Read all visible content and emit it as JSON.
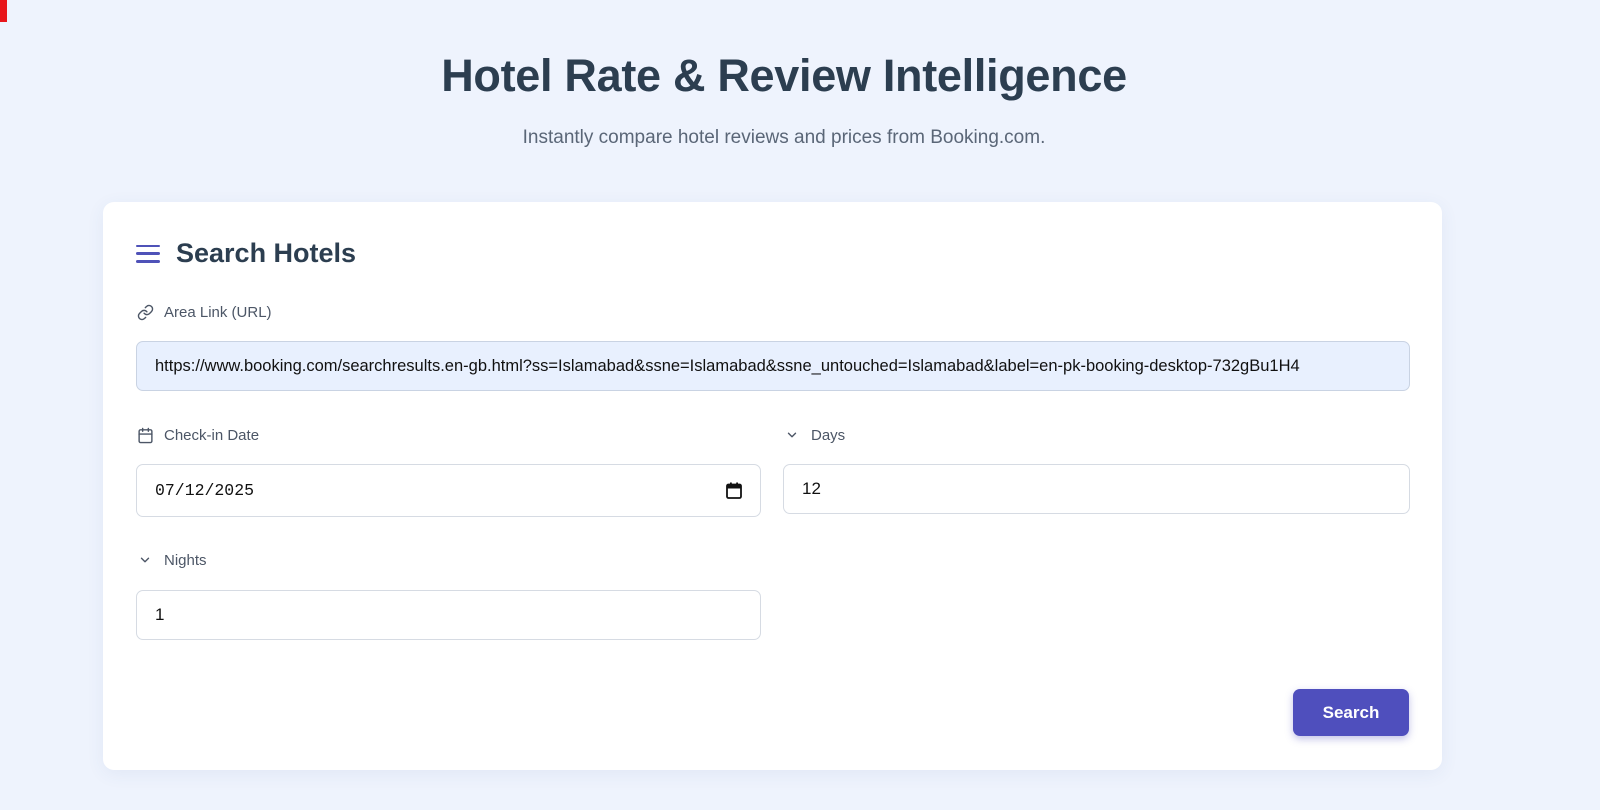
{
  "header": {
    "title": "Hotel Rate & Review Intelligence",
    "subtitle": "Instantly compare hotel reviews and prices from Booking.com."
  },
  "card": {
    "title": "Search Hotels",
    "title_icon": "menu-icon"
  },
  "fields": {
    "area_link": {
      "label": "Area Link (URL)",
      "icon": "link-icon",
      "value": "https://www.booking.com/searchresults.en-gb.html?ss=Islamabad&ssne=Islamabad&ssne_untouched=Islamabad&label=en-pk-booking-desktop-732gBu1H4"
    },
    "check_in": {
      "label": "Check-in Date",
      "icon": "calendar-icon",
      "value": "07/12/2025"
    },
    "days": {
      "label": "Days",
      "icon": "chevron-down-icon",
      "value": "12"
    },
    "nights": {
      "label": "Nights",
      "icon": "chevron-down-icon",
      "value": "1"
    }
  },
  "actions": {
    "search_label": "Search"
  },
  "colors": {
    "background": "#eef3fd",
    "accent": "#4f4fbd",
    "url_field_bg": "#e8f0fe"
  }
}
